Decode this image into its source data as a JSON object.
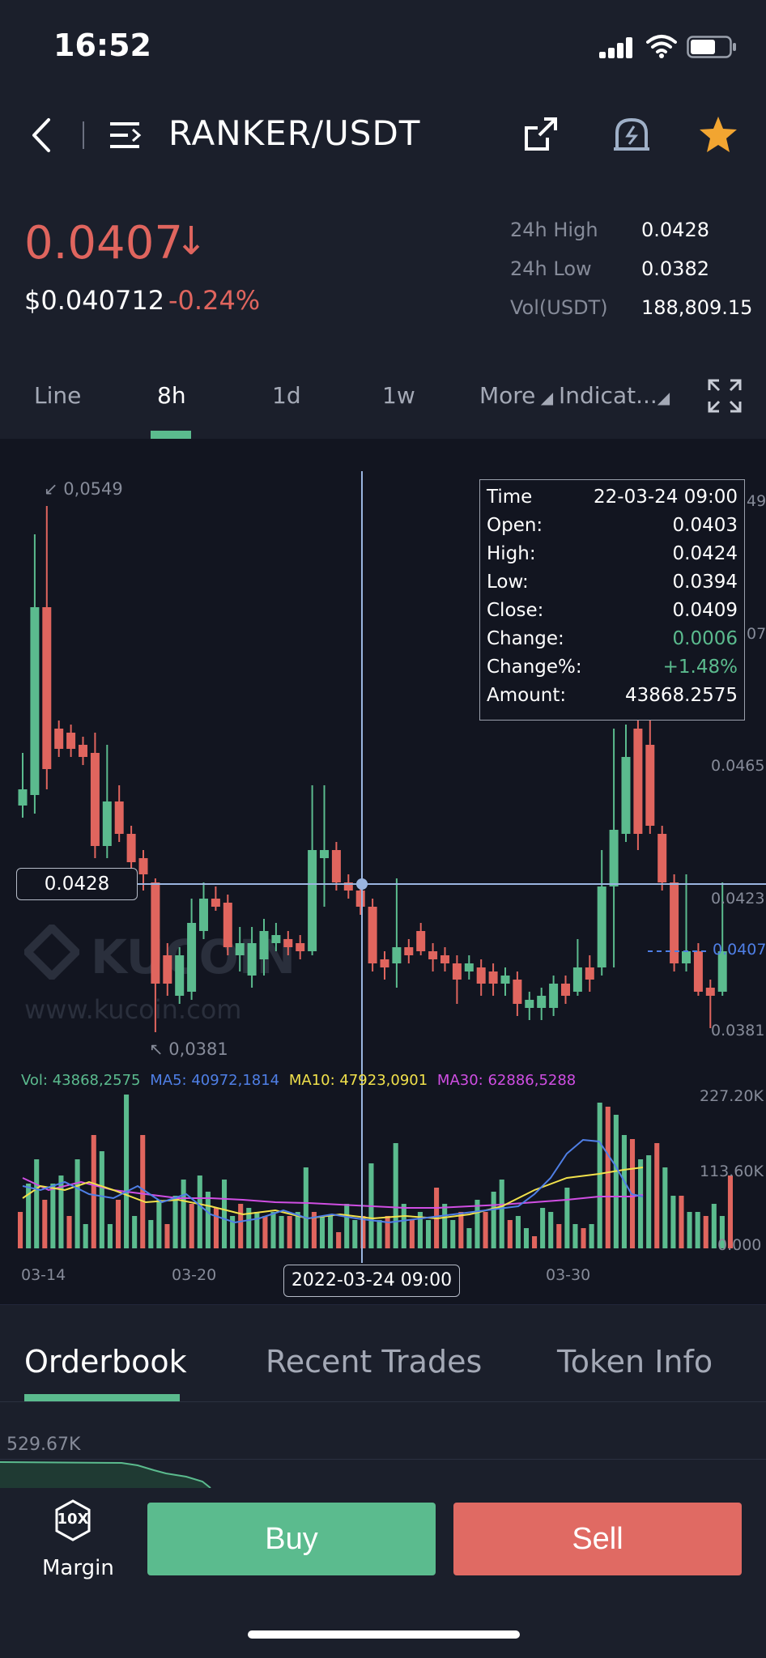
{
  "status": {
    "time": "16:52"
  },
  "header": {
    "pair": "RANKER/USDT"
  },
  "price": {
    "last": "0.0407",
    "usd": "$0.040712",
    "change": "-0.24%",
    "stats": [
      {
        "label": "24h High",
        "value": "0.0428"
      },
      {
        "label": "24h Low",
        "value": "0.0382"
      },
      {
        "label": "Vol(USDT)",
        "value": "188,809.15"
      }
    ]
  },
  "intervals": {
    "items": [
      "Line",
      "8h",
      "1d",
      "1w",
      "More"
    ],
    "active": "8h",
    "indicators": "Indicat..."
  },
  "tooltip": {
    "rows": [
      {
        "label": "Time",
        "value": "22-03-24 09:00"
      },
      {
        "label": "Open:",
        "value": "0.0403"
      },
      {
        "label": "High:",
        "value": "0.0424"
      },
      {
        "label": "Low:",
        "value": "0.0394"
      },
      {
        "label": "Close:",
        "value": "0.0409"
      },
      {
        "label": "Change:",
        "value": "0.0006"
      },
      {
        "label": "Change%:",
        "value": "+1.48%"
      },
      {
        "label": "Amount:",
        "value": "43868.2575"
      }
    ]
  },
  "chart": {
    "max_label": "0,0549",
    "min_label": "0,0381",
    "crosshair_price": "0.0428",
    "crosshair_date": "2022-03-24 09:00",
    "price_axis": [
      "49",
      "07",
      "0.0465",
      "0.0423",
      "0.0381"
    ],
    "current_price": "0.0407",
    "volume_axis": [
      "227.20K",
      "113.60K",
      "0.000"
    ],
    "date_axis": [
      "03-14",
      "03-20",
      "03-30"
    ],
    "legend": {
      "vol": "Vol: 43868,2575",
      "ma5": "MA5: 40972,1814",
      "ma10": "MA10: 47923,0901",
      "ma30": "MA30: 62886,5288"
    },
    "watermark_brand": "KUCOIN",
    "watermark_url": "www.kucoin.com"
  },
  "colors": {
    "up": "#5bbb8e",
    "down": "#e0655e",
    "ma5": "#4f7fe6",
    "ma10": "#f1e14b",
    "ma30": "#d04ee3"
  },
  "bottom_tabs": {
    "items": [
      "Orderbook",
      "Recent Trades",
      "Token Info"
    ],
    "active": "Orderbook"
  },
  "orderbook": {
    "depth_label": "529.67K"
  },
  "actions": {
    "margin": "Margin",
    "margin_badge": "10X",
    "buy": "Buy",
    "sell": "Sell"
  }
}
